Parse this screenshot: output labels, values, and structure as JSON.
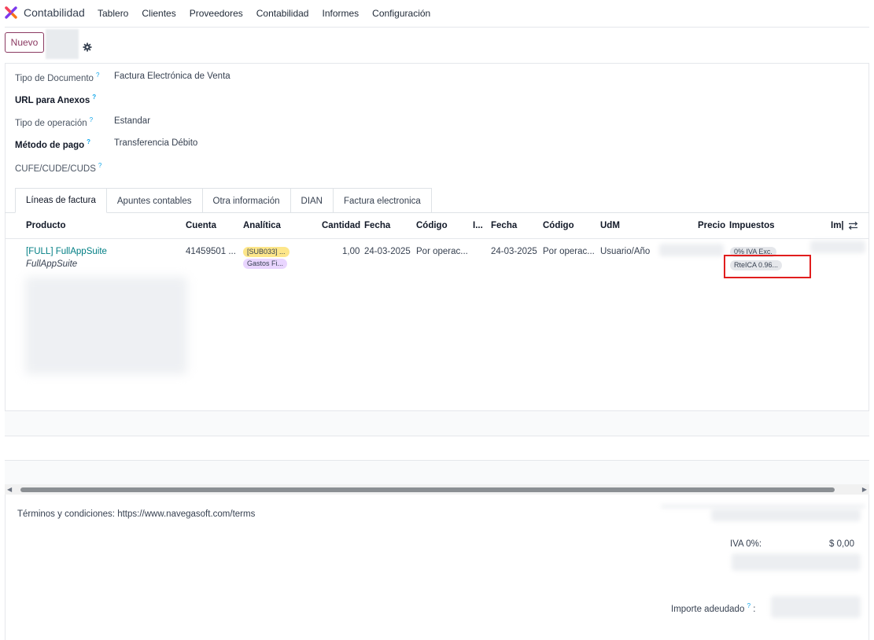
{
  "nav": {
    "app_name": "Contabilidad",
    "menu": [
      "Tablero",
      "Clientes",
      "Proveedores",
      "Contabilidad",
      "Informes",
      "Configuración"
    ]
  },
  "control": {
    "new_label": "Nuevo"
  },
  "fields": [
    {
      "label": "Tipo de Documento",
      "value": "Factura Electrónica de Venta",
      "bold": false
    },
    {
      "label": "URL para Anexos",
      "value": "",
      "bold": true
    },
    {
      "label": "Tipo de operación",
      "value": "Estandar",
      "bold": false
    },
    {
      "label": "Método de pago",
      "value": "Transferencia Débito",
      "bold": true
    },
    {
      "label": "CUFE/CUDE/CUDS",
      "value": "",
      "bold": false
    }
  ],
  "help_mark": "?",
  "tabs": [
    "Líneas de factura",
    "Apuntes contables",
    "Otra información",
    "DIAN",
    "Factura electronica"
  ],
  "table": {
    "headers": {
      "producto": "Producto",
      "cuenta": "Cuenta",
      "analitica": "Analítica",
      "cantidad": "Cantidad",
      "fecha1": "Fecha",
      "codigo1": "Código",
      "i": "I...",
      "fecha2": "Fecha",
      "codigo2": "Código",
      "udm": "UdM",
      "precio": "Precio",
      "impuestos": "Impuestos",
      "imp": "Im|"
    },
    "row": {
      "producto": "[FULL] FullAppSuite",
      "descripcion": "FullAppSuite",
      "cuenta": "41459501 ...",
      "analitica_tags": [
        "[SUB033] ...",
        "Gastos Fi..."
      ],
      "cantidad": "1,00",
      "fecha1": "24-03-2025",
      "codigo1": "Por operac...",
      "fecha2": "24-03-2025",
      "codigo2": "Por operac...",
      "udm": "Usuario/Año",
      "impuestos_tags": [
        "0% IVA Exc.",
        "RteICA 0.96..."
      ]
    }
  },
  "footer": {
    "terms": "Términos y condiciones: https://www.navegasoft.com/terms",
    "iva_label": "IVA 0%:",
    "iva_value": "$ 0,00",
    "importe_label": "Importe adeudado",
    "importe_suffix": ":"
  },
  "colors": {
    "accent": "#8b3a62",
    "link": "#017e84",
    "highlight": "#e11d1d"
  }
}
